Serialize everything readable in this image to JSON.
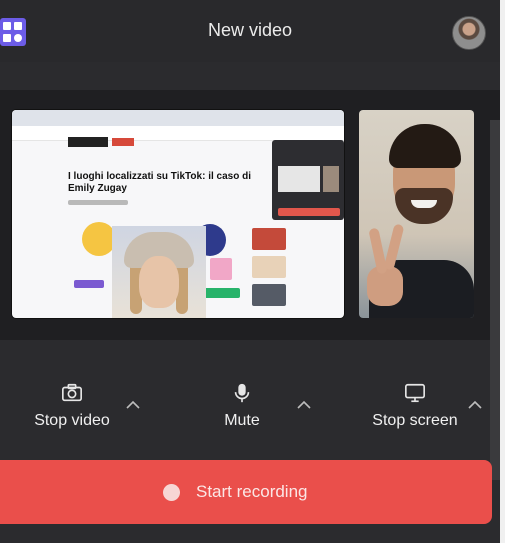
{
  "window": {
    "title": "New video",
    "colors": {
      "background": "#2b2b2e",
      "accent": "#ea4f4b",
      "logo": "#6c5ce7",
      "text": "#f0f0f0"
    }
  },
  "header": {
    "logo_icon": "app-logo-icon",
    "avatar_icon": "user-avatar"
  },
  "screen_preview": {
    "headline": "I luoghi localizzati su TikTok: il caso di Emily Zugay"
  },
  "controls": [
    {
      "label": "Stop video",
      "icon": "camera-icon"
    },
    {
      "label": "Mute",
      "icon": "microphone-icon"
    },
    {
      "label": "Stop screen",
      "icon": "monitor-icon"
    }
  ],
  "record": {
    "label": "Start recording",
    "icon": "record-dot-icon"
  }
}
